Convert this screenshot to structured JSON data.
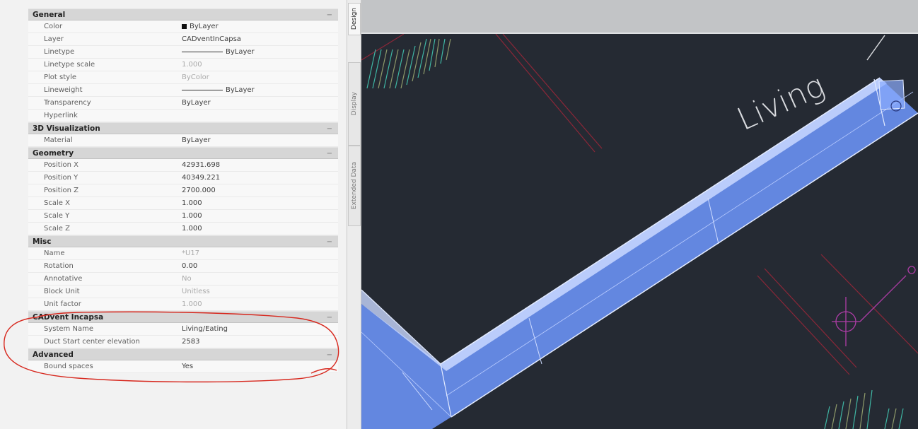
{
  "palette": {
    "sections": [
      {
        "title": "General",
        "collapse": "−",
        "rows": [
          {
            "key": "Color",
            "value": "ByLayer",
            "style": "swatch"
          },
          {
            "key": "Layer",
            "value": "CADventInCapsa"
          },
          {
            "key": "Linetype",
            "value": "ByLayer",
            "style": "line"
          },
          {
            "key": "Linetype scale",
            "value": "1.000",
            "style": "dim"
          },
          {
            "key": "Plot style",
            "value": "ByColor",
            "style": "dim"
          },
          {
            "key": "Lineweight",
            "value": "ByLayer",
            "style": "line"
          },
          {
            "key": "Transparency",
            "value": "ByLayer"
          },
          {
            "key": "Hyperlink",
            "value": ""
          }
        ]
      },
      {
        "title": "3D Visualization",
        "collapse": "−",
        "rows": [
          {
            "key": "Material",
            "value": "ByLayer"
          }
        ]
      },
      {
        "title": "Geometry",
        "collapse": "−",
        "rows": [
          {
            "key": "Position X",
            "value": "42931.698"
          },
          {
            "key": "Position Y",
            "value": "40349.221"
          },
          {
            "key": "Position Z",
            "value": "2700.000"
          },
          {
            "key": "Scale X",
            "value": "1.000"
          },
          {
            "key": "Scale Y",
            "value": "1.000"
          },
          {
            "key": "Scale Z",
            "value": "1.000"
          }
        ]
      },
      {
        "title": "Misc",
        "collapse": "−",
        "rows": [
          {
            "key": "Name",
            "value": "*U17",
            "style": "dim"
          },
          {
            "key": "Rotation",
            "value": "0.00"
          },
          {
            "key": "Annotative",
            "value": "No",
            "style": "dim"
          },
          {
            "key": "Block Unit",
            "value": "Unitless",
            "style": "dim"
          },
          {
            "key": "Unit factor",
            "value": "1.000",
            "style": "dim"
          }
        ]
      },
      {
        "title": "CADvent Incapsa",
        "collapse": "−",
        "rows": [
          {
            "key": "System Name",
            "value": "Living/Eating"
          },
          {
            "key": "Duct Start center elevation",
            "value": "2583"
          }
        ]
      },
      {
        "title": "Advanced",
        "collapse": "−",
        "rows": [
          {
            "key": "Bound spaces",
            "value": "Yes"
          }
        ]
      }
    ]
  },
  "tabs": [
    {
      "label": "Design",
      "active": true
    },
    {
      "label": "Display",
      "active": false
    },
    {
      "label": "Extended Data",
      "active": false
    }
  ],
  "viewport": {
    "room_label": "Living",
    "background_color": "#252a33",
    "duct_color": "#6f98ff"
  },
  "annotation": {
    "color": "#d7281e"
  }
}
